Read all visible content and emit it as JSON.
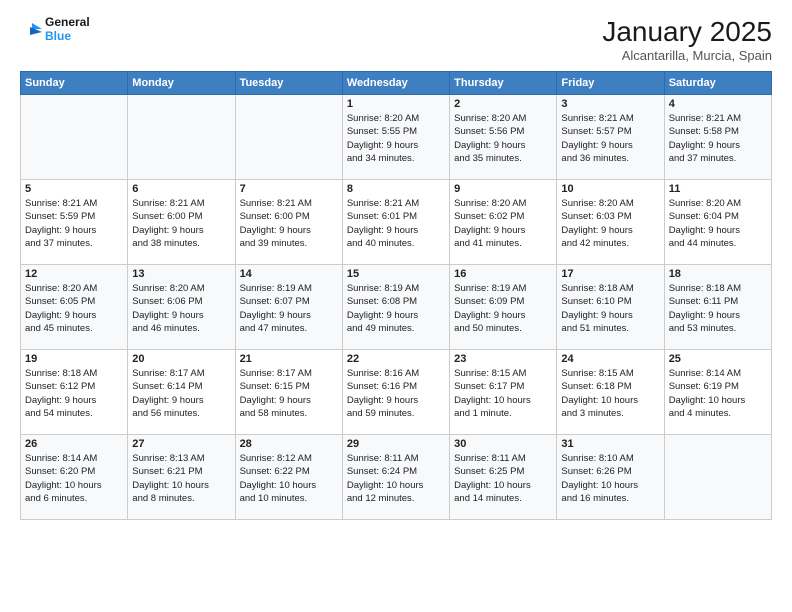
{
  "header": {
    "logo_line1": "General",
    "logo_line2": "Blue",
    "month": "January 2025",
    "location": "Alcantarilla, Murcia, Spain"
  },
  "days_of_week": [
    "Sunday",
    "Monday",
    "Tuesday",
    "Wednesday",
    "Thursday",
    "Friday",
    "Saturday"
  ],
  "weeks": [
    [
      {
        "day": "",
        "content": ""
      },
      {
        "day": "",
        "content": ""
      },
      {
        "day": "",
        "content": ""
      },
      {
        "day": "1",
        "content": "Sunrise: 8:20 AM\nSunset: 5:55 PM\nDaylight: 9 hours\nand 34 minutes."
      },
      {
        "day": "2",
        "content": "Sunrise: 8:20 AM\nSunset: 5:56 PM\nDaylight: 9 hours\nand 35 minutes."
      },
      {
        "day": "3",
        "content": "Sunrise: 8:21 AM\nSunset: 5:57 PM\nDaylight: 9 hours\nand 36 minutes."
      },
      {
        "day": "4",
        "content": "Sunrise: 8:21 AM\nSunset: 5:58 PM\nDaylight: 9 hours\nand 37 minutes."
      }
    ],
    [
      {
        "day": "5",
        "content": "Sunrise: 8:21 AM\nSunset: 5:59 PM\nDaylight: 9 hours\nand 37 minutes."
      },
      {
        "day": "6",
        "content": "Sunrise: 8:21 AM\nSunset: 6:00 PM\nDaylight: 9 hours\nand 38 minutes."
      },
      {
        "day": "7",
        "content": "Sunrise: 8:21 AM\nSunset: 6:00 PM\nDaylight: 9 hours\nand 39 minutes."
      },
      {
        "day": "8",
        "content": "Sunrise: 8:21 AM\nSunset: 6:01 PM\nDaylight: 9 hours\nand 40 minutes."
      },
      {
        "day": "9",
        "content": "Sunrise: 8:20 AM\nSunset: 6:02 PM\nDaylight: 9 hours\nand 41 minutes."
      },
      {
        "day": "10",
        "content": "Sunrise: 8:20 AM\nSunset: 6:03 PM\nDaylight: 9 hours\nand 42 minutes."
      },
      {
        "day": "11",
        "content": "Sunrise: 8:20 AM\nSunset: 6:04 PM\nDaylight: 9 hours\nand 44 minutes."
      }
    ],
    [
      {
        "day": "12",
        "content": "Sunrise: 8:20 AM\nSunset: 6:05 PM\nDaylight: 9 hours\nand 45 minutes."
      },
      {
        "day": "13",
        "content": "Sunrise: 8:20 AM\nSunset: 6:06 PM\nDaylight: 9 hours\nand 46 minutes."
      },
      {
        "day": "14",
        "content": "Sunrise: 8:19 AM\nSunset: 6:07 PM\nDaylight: 9 hours\nand 47 minutes."
      },
      {
        "day": "15",
        "content": "Sunrise: 8:19 AM\nSunset: 6:08 PM\nDaylight: 9 hours\nand 49 minutes."
      },
      {
        "day": "16",
        "content": "Sunrise: 8:19 AM\nSunset: 6:09 PM\nDaylight: 9 hours\nand 50 minutes."
      },
      {
        "day": "17",
        "content": "Sunrise: 8:18 AM\nSunset: 6:10 PM\nDaylight: 9 hours\nand 51 minutes."
      },
      {
        "day": "18",
        "content": "Sunrise: 8:18 AM\nSunset: 6:11 PM\nDaylight: 9 hours\nand 53 minutes."
      }
    ],
    [
      {
        "day": "19",
        "content": "Sunrise: 8:18 AM\nSunset: 6:12 PM\nDaylight: 9 hours\nand 54 minutes."
      },
      {
        "day": "20",
        "content": "Sunrise: 8:17 AM\nSunset: 6:14 PM\nDaylight: 9 hours\nand 56 minutes."
      },
      {
        "day": "21",
        "content": "Sunrise: 8:17 AM\nSunset: 6:15 PM\nDaylight: 9 hours\nand 58 minutes."
      },
      {
        "day": "22",
        "content": "Sunrise: 8:16 AM\nSunset: 6:16 PM\nDaylight: 9 hours\nand 59 minutes."
      },
      {
        "day": "23",
        "content": "Sunrise: 8:15 AM\nSunset: 6:17 PM\nDaylight: 10 hours\nand 1 minute."
      },
      {
        "day": "24",
        "content": "Sunrise: 8:15 AM\nSunset: 6:18 PM\nDaylight: 10 hours\nand 3 minutes."
      },
      {
        "day": "25",
        "content": "Sunrise: 8:14 AM\nSunset: 6:19 PM\nDaylight: 10 hours\nand 4 minutes."
      }
    ],
    [
      {
        "day": "26",
        "content": "Sunrise: 8:14 AM\nSunset: 6:20 PM\nDaylight: 10 hours\nand 6 minutes."
      },
      {
        "day": "27",
        "content": "Sunrise: 8:13 AM\nSunset: 6:21 PM\nDaylight: 10 hours\nand 8 minutes."
      },
      {
        "day": "28",
        "content": "Sunrise: 8:12 AM\nSunset: 6:22 PM\nDaylight: 10 hours\nand 10 minutes."
      },
      {
        "day": "29",
        "content": "Sunrise: 8:11 AM\nSunset: 6:24 PM\nDaylight: 10 hours\nand 12 minutes."
      },
      {
        "day": "30",
        "content": "Sunrise: 8:11 AM\nSunset: 6:25 PM\nDaylight: 10 hours\nand 14 minutes."
      },
      {
        "day": "31",
        "content": "Sunrise: 8:10 AM\nSunset: 6:26 PM\nDaylight: 10 hours\nand 16 minutes."
      },
      {
        "day": "",
        "content": ""
      }
    ]
  ]
}
